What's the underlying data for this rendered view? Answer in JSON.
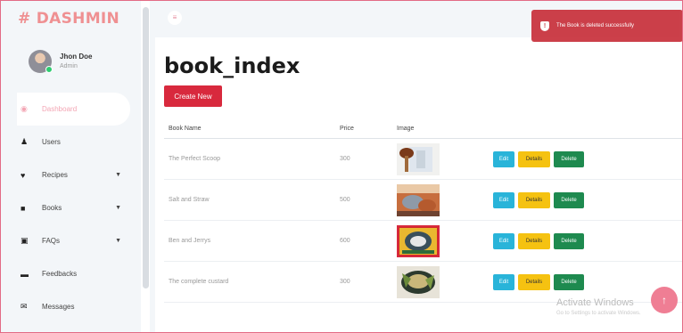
{
  "app": {
    "brand": "# DASHMIN"
  },
  "user": {
    "name": "Jhon Doe",
    "role": "Admin"
  },
  "sidebar": {
    "items": [
      {
        "label": "Dashboard",
        "icon": "speedometer-icon"
      },
      {
        "label": "Users",
        "icon": "users-icon"
      },
      {
        "label": "Recipes",
        "icon": "recipes-icon"
      },
      {
        "label": "Books",
        "icon": "books-icon"
      },
      {
        "label": "FAQs",
        "icon": "faqs-icon"
      },
      {
        "label": "Feedbacks",
        "icon": "feedback-icon"
      },
      {
        "label": "Messages",
        "icon": "messages-icon"
      }
    ]
  },
  "toast": {
    "message": "The Book is deleted successfully"
  },
  "page": {
    "title": "book_index",
    "create_label": "Create New"
  },
  "table": {
    "headers": [
      "Book Name",
      "Price",
      "Image"
    ],
    "rows": [
      {
        "name": "The Perfect Scoop",
        "price": "300"
      },
      {
        "name": "Salt and Straw",
        "price": "500"
      },
      {
        "name": "Ben and Jerrys",
        "price": "600"
      },
      {
        "name": "The complete custard",
        "price": "300"
      }
    ],
    "actions": {
      "edit": "Edit",
      "details": "Details",
      "delete": "Delete"
    }
  },
  "watermark": {
    "title": "Activate Windows",
    "subtitle": "Go to Settings to activate Windows."
  },
  "colors": {
    "accent": "#eb1616",
    "danger": "#d8293d",
    "info": "#29b4d9",
    "warning": "#f5c211",
    "success": "#1e8a4f"
  }
}
